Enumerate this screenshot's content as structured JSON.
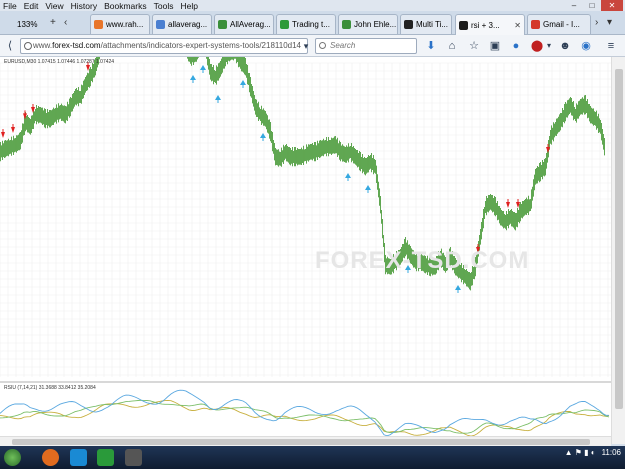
{
  "menu": [
    "File",
    "Edit",
    "View",
    "History",
    "Bookmarks",
    "Tools",
    "Help"
  ],
  "window_controls": {
    "minimize": "–",
    "maximize": "□",
    "close": "✕"
  },
  "tabs": [
    {
      "label": "133%",
      "color": "#cfdbe9"
    },
    {
      "label": "www.rah...",
      "color": "#e8762b"
    },
    {
      "label": "allaverag...",
      "color": "#4a7fd1"
    },
    {
      "label": "AllAverag...",
      "color": "#3b8f3b"
    },
    {
      "label": "Trading t...",
      "color": "#2e9a3a"
    },
    {
      "label": "John Ehle...",
      "color": "#3b8f3b"
    },
    {
      "label": "Multi Ti...",
      "color": "#222222"
    },
    {
      "label": "rsi + 3...",
      "color": "#1c1c1c"
    },
    {
      "label": "Gmail - I...",
      "color": "#d4382a"
    }
  ],
  "url": {
    "prefix": "www.",
    "domain": "forex-tsd.com",
    "path": "/attachments/indicators-expert-systems-tools/218110d14"
  },
  "search": {
    "placeholder": "Search"
  },
  "chart": {
    "header": "EURUSD,M30  1.07415 1.07446 1.07287 1.07424",
    "rsi_header": "RSIU (7,14,21) 31.3688 33.8412 35.2084",
    "watermark": "FOREX-TSD.COM",
    "colors": {
      "candles": "#4f9e3f",
      "sell": "#e02020",
      "buy": "#35a8e0",
      "rsi1": "#5aa8e0",
      "rsi2": "#c8b040",
      "rsi3": "#7cbf6a"
    }
  },
  "chart_data": {
    "type": "line",
    "x": [
      0,
      5,
      10,
      15,
      20,
      25,
      30,
      35,
      40,
      45,
      50,
      55,
      60,
      65,
      70,
      75,
      80,
      85,
      90,
      95,
      100,
      105,
      110,
      115,
      120,
      125,
      130,
      135,
      140,
      145,
      150,
      155,
      160,
      165,
      170,
      175,
      180,
      185,
      190,
      195,
      200,
      205,
      210,
      215,
      220,
      225,
      230,
      235,
      240,
      245,
      250,
      255,
      260,
      265,
      270,
      275,
      280,
      285,
      290,
      295,
      300,
      305,
      310,
      315,
      320,
      325,
      330,
      335,
      340,
      345,
      350,
      355,
      360,
      365,
      370,
      375,
      380,
      385,
      390,
      395,
      400,
      405,
      410,
      415,
      420,
      425,
      430,
      435,
      440,
      445,
      450,
      455,
      460,
      465,
      470,
      475,
      480,
      485,
      490,
      495,
      500,
      505,
      510,
      515,
      520,
      525,
      530,
      535,
      540,
      545,
      550,
      555,
      560,
      565,
      570,
      575,
      580,
      585,
      590,
      595,
      600,
      605
    ],
    "series": [
      {
        "values": [
          225,
          228,
          230,
          232,
          236,
          255,
          250,
          262,
          262,
          258,
          258,
          262,
          265,
          262,
          270,
          280,
          280,
          292,
          300,
          310,
          328,
          340,
          340,
          348,
          352,
          355,
          348,
          343,
          340,
          338,
          340,
          335,
          334,
          340,
          348,
          345,
          338,
          330,
          320,
          322,
          330,
          330,
          305,
          300,
          308,
          320,
          325,
          325,
          315,
          310,
          290,
          270,
          262,
          258,
          245,
          220,
          218,
          225,
          220,
          220,
          220,
          222,
          225,
          225,
          228,
          230,
          230,
          232,
          225,
          222,
          225,
          220,
          215,
          210,
          215,
          210,
          172,
          112,
          110,
          115,
          120,
          130,
          122,
          115,
          115,
          112,
          110,
          110,
          120,
          112,
          120,
          110,
          105,
          100,
          95,
          110,
          140,
          170,
          175,
          170,
          160,
          155,
          160,
          155,
          165,
          170,
          172,
          200,
          205,
          210,
          240,
          248,
          255,
          265,
          272,
          262,
          270,
          272,
          262,
          258,
          250,
          225
        ]
      }
    ],
    "sell_arrows_x": [
      0,
      10,
      22,
      30,
      85,
      135,
      475,
      505,
      515,
      545
    ],
    "buy_arrows_x": [
      170,
      190,
      200,
      215,
      240,
      260,
      345,
      365,
      405,
      455
    ]
  }
}
